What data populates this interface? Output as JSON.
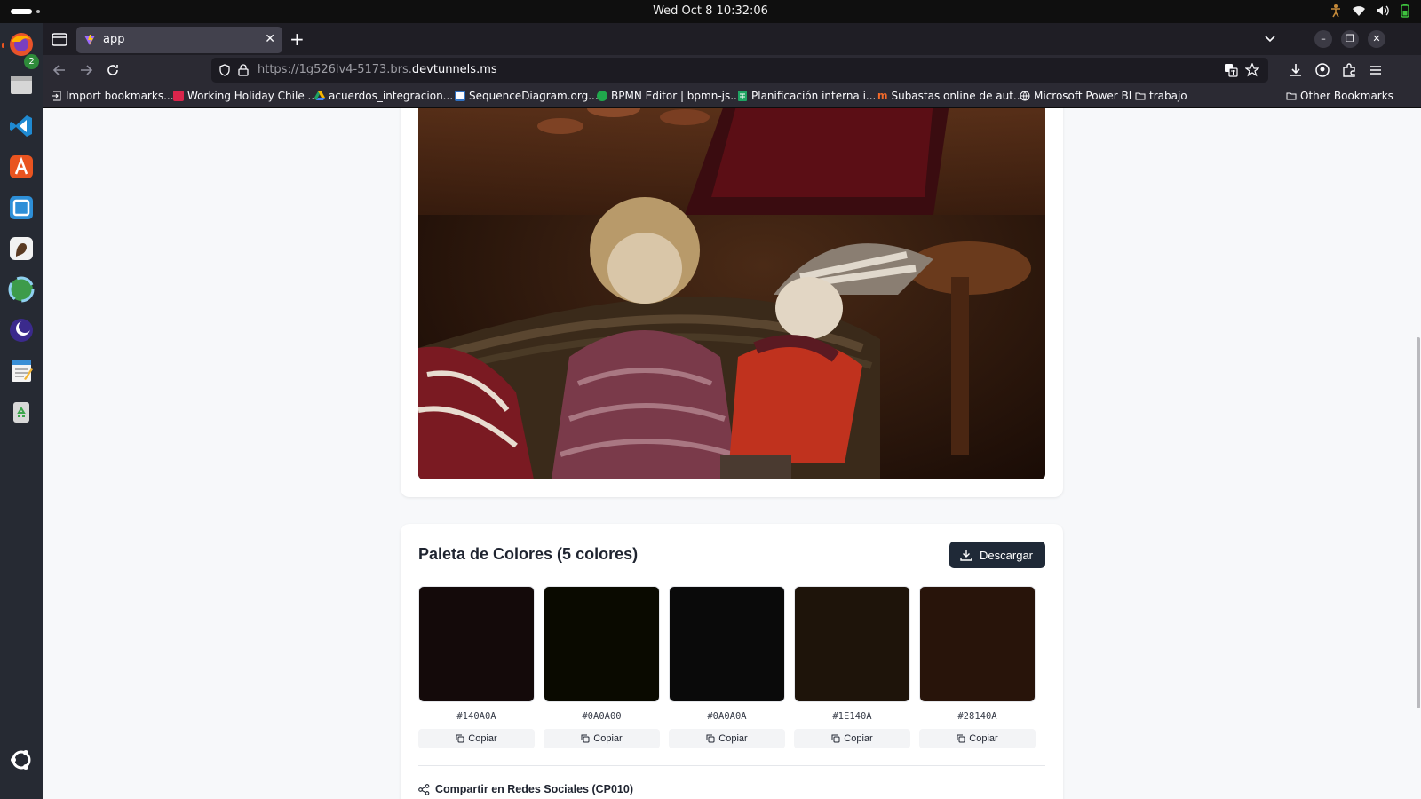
{
  "system": {
    "clock": "Wed Oct 8  10:32:06",
    "dock_badge": "2"
  },
  "browser": {
    "tab_title": "app",
    "url_prefix": "https://1g526lv4-5173.brs.",
    "url_domain": "devtunnels.ms",
    "bookmarks": [
      {
        "label": "Import bookmarks...",
        "icon": "import-icon"
      },
      {
        "label": "Working Holiday Chile ...",
        "icon": "red-favicon"
      },
      {
        "label": "acuerdos_integracion...",
        "icon": "drive-icon"
      },
      {
        "label": "SequenceDiagram.org...",
        "icon": "sequence-icon"
      },
      {
        "label": "BPMN Editor | bpmn-js...",
        "icon": "bpmn-icon"
      },
      {
        "label": "Planificación interna i...",
        "icon": "sheets-icon"
      },
      {
        "label": "Subastas online de aut...",
        "icon": "subastas-icon"
      },
      {
        "label": "Microsoft Power BI",
        "icon": "globe-icon"
      },
      {
        "label": "trabajo",
        "icon": "folder-icon"
      }
    ],
    "other_bookmarks": "Other Bookmarks"
  },
  "palette": {
    "title": "Paleta de Colores (5 colores)",
    "download_label": "Descargar",
    "copy_label": "Copiar",
    "colors": [
      {
        "hex": "#140A0A"
      },
      {
        "hex": "#0A0A00"
      },
      {
        "hex": "#0A0A0A"
      },
      {
        "hex": "#1E140A"
      },
      {
        "hex": "#28140A"
      }
    ],
    "share_label": "Compartir en Redes Sociales (CP010)"
  }
}
